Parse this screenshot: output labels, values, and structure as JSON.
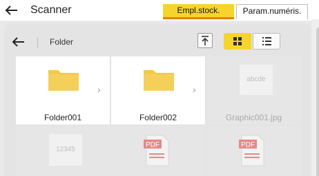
{
  "header": {
    "title": "Scanner",
    "tabs": [
      {
        "label": "Empl.stock.",
        "active": true
      },
      {
        "label": "Param.numéris.",
        "active": false
      }
    ]
  },
  "folder_bar": {
    "label": "Folder",
    "view_mode": "grid"
  },
  "items": [
    {
      "name": "Folder001",
      "type": "folder",
      "enabled": true
    },
    {
      "name": "Folder002",
      "type": "folder",
      "enabled": true
    },
    {
      "name": "Graphic001.jpg",
      "type": "image",
      "thumb_text": "abcde",
      "enabled": false
    },
    {
      "name": "",
      "type": "image",
      "thumb_text": "12345",
      "enabled": false
    },
    {
      "name": "",
      "type": "pdf",
      "badge": "PDF",
      "enabled": false
    },
    {
      "name": "",
      "type": "pdf",
      "badge": "PDF",
      "enabled": false
    }
  ],
  "colors": {
    "accent": "#f7d42b",
    "accent_underline": "#e88000",
    "folder": "#f2c94c",
    "pdf": "#e07a7a"
  },
  "icons": {
    "back": "arrow-left-icon",
    "upload": "arrow-up-to-line-icon",
    "grid_view": "grid-icon",
    "list_view": "list-icon",
    "chevron": "chevron-right-icon"
  }
}
